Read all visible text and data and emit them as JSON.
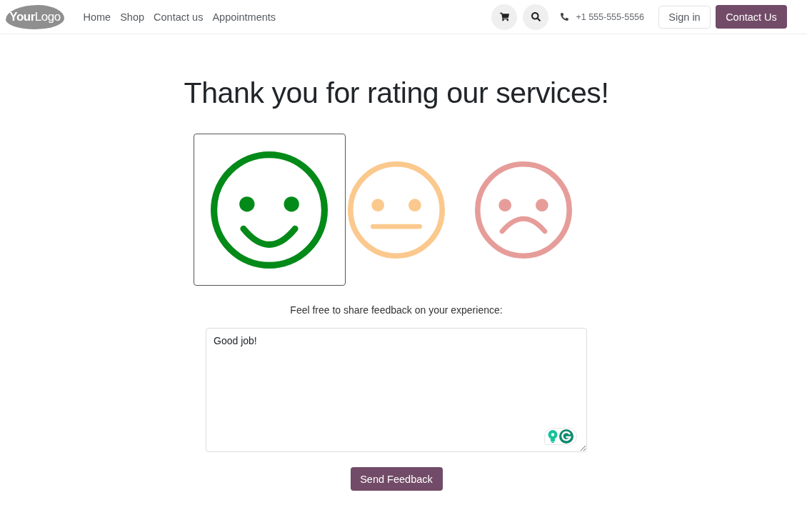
{
  "header": {
    "logo": "**Your**Logo",
    "nav_links": [
      "Home",
      "Shop",
      "Contact us",
      "Appointments"
    ],
    "phone": "+1 555-555-5556",
    "sign_in_button": "Sign in",
    "contact_button": "Contact Us"
  },
  "heading": "Thank you for rating our services!",
  "ratings": [
    {
      "kind": "happy",
      "selected": true,
      "color": "#038a18"
    },
    {
      "kind": "neutral",
      "selected": false,
      "color": "#fbc98e"
    },
    {
      "kind": "sad",
      "selected": false,
      "color": "#e69d9a"
    }
  ],
  "feedback": {
    "label": "Feel free to share feedback on your experience:",
    "value": "Good job!"
  },
  "submit_button": "Send Feedback"
}
